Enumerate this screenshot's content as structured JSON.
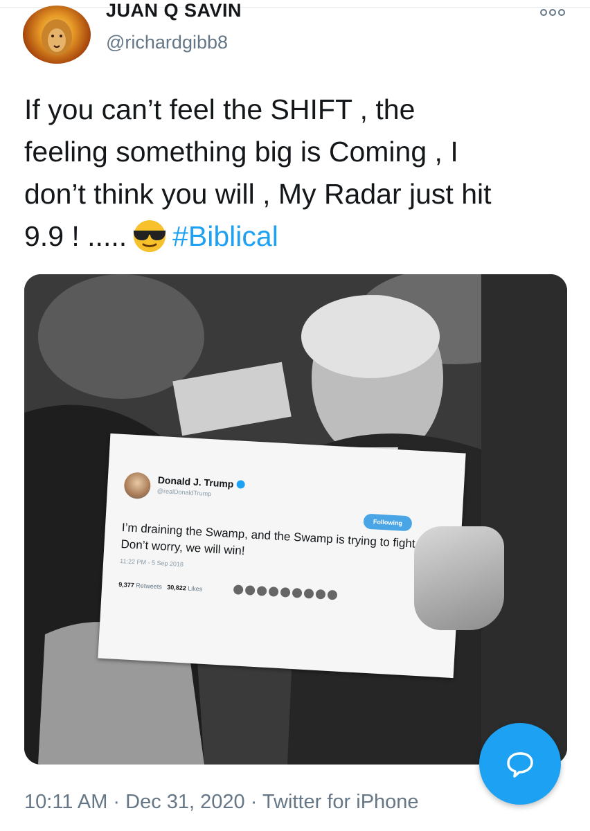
{
  "author": {
    "name": "JUAN Q SAVIN",
    "handle": "@richardgibb8",
    "avatar_icon": "lion-avatar"
  },
  "tweet": {
    "text_line1": "If you can’t feel the SHIFT , the",
    "text_line2": "feeling something big is Coming , I",
    "text_line3": "don’t think you will , My Radar just hit",
    "text_line4_prefix": "9.9 ! .....",
    "emoji": "sunglasses-emoji",
    "hashtag": "#Biblical"
  },
  "embedded_card": {
    "name": "Donald J. Trump",
    "handle": "@realDonaldTrump",
    "follow_label": "Following",
    "text": "I’m draining the Swamp, and the Swamp is trying to fight back. Don’t worry, we will win!",
    "time": "11:22 PM - 5 Sep 2018",
    "retweets_count": "9,377",
    "retweets_label": "Retweets",
    "likes_count": "30,822",
    "likes_label": "Likes"
  },
  "footer": {
    "timestamp": "10:11 AM · Dec 31, 2020 · Twitter for iPhone"
  },
  "colors": {
    "link": "#1da1f2",
    "secondary_text": "#657786",
    "fab": "#1da1f2"
  },
  "icons": {
    "more": "more-options-icon",
    "fab": "compose-reply-icon"
  }
}
